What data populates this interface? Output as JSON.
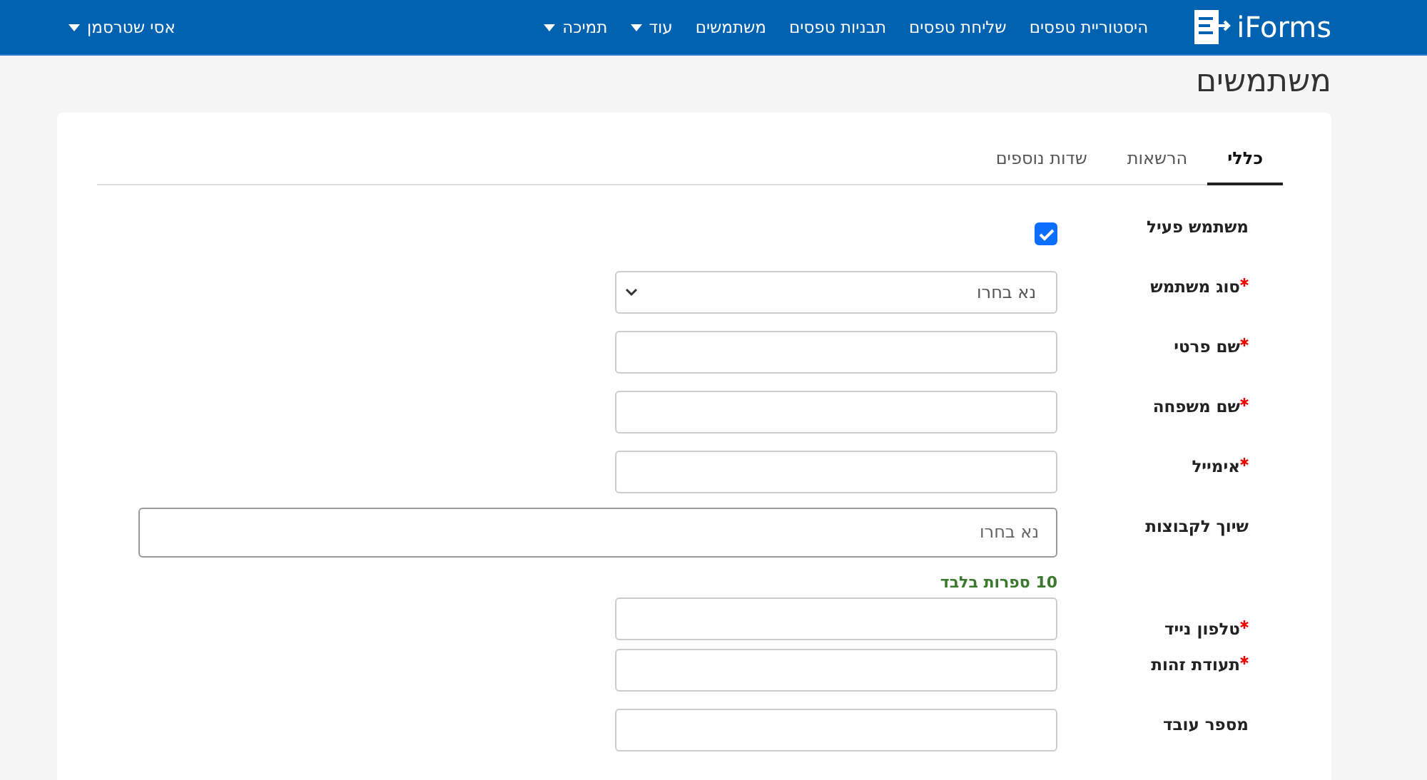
{
  "navbar": {
    "logo": "iForms",
    "links": [
      {
        "label": "היסטוריית טפסים",
        "dropdown": false
      },
      {
        "label": "שליחת טפסים",
        "dropdown": false
      },
      {
        "label": "תבניות טפסים",
        "dropdown": false
      },
      {
        "label": "משתמשים",
        "dropdown": false
      },
      {
        "label": "עוד",
        "dropdown": true
      },
      {
        "label": "תמיכה",
        "dropdown": true
      }
    ],
    "user": "אסי שטרסמן"
  },
  "page_title": "משתמשים",
  "tabs": [
    {
      "label": "כללי",
      "selected": true
    },
    {
      "label": "הרשאות",
      "selected": false
    },
    {
      "label": "שדות נוספים",
      "selected": false
    }
  ],
  "fields": [
    {
      "kind": "checkbox",
      "label": "משתמש פעיל",
      "required": false,
      "checked": true
    },
    {
      "kind": "select",
      "label": "סוג משתמש",
      "required": true,
      "placeholder": "נא בחרו"
    },
    {
      "kind": "text",
      "label": "שם פרטי",
      "required": true
    },
    {
      "kind": "text",
      "label": "שם משפחה",
      "required": true
    },
    {
      "kind": "text",
      "label": "אימייל",
      "required": true
    },
    {
      "kind": "multiselect",
      "label": "שיוך לקבוצות",
      "required": false,
      "placeholder": "נא בחרו"
    },
    {
      "kind": "text",
      "label": "טלפון נייד",
      "required": true,
      "hint": "10 ספרות בלבד"
    },
    {
      "kind": "text",
      "label": "תעודת זהות",
      "required": true
    },
    {
      "kind": "text",
      "label": "מספר עובד",
      "required": false
    }
  ]
}
